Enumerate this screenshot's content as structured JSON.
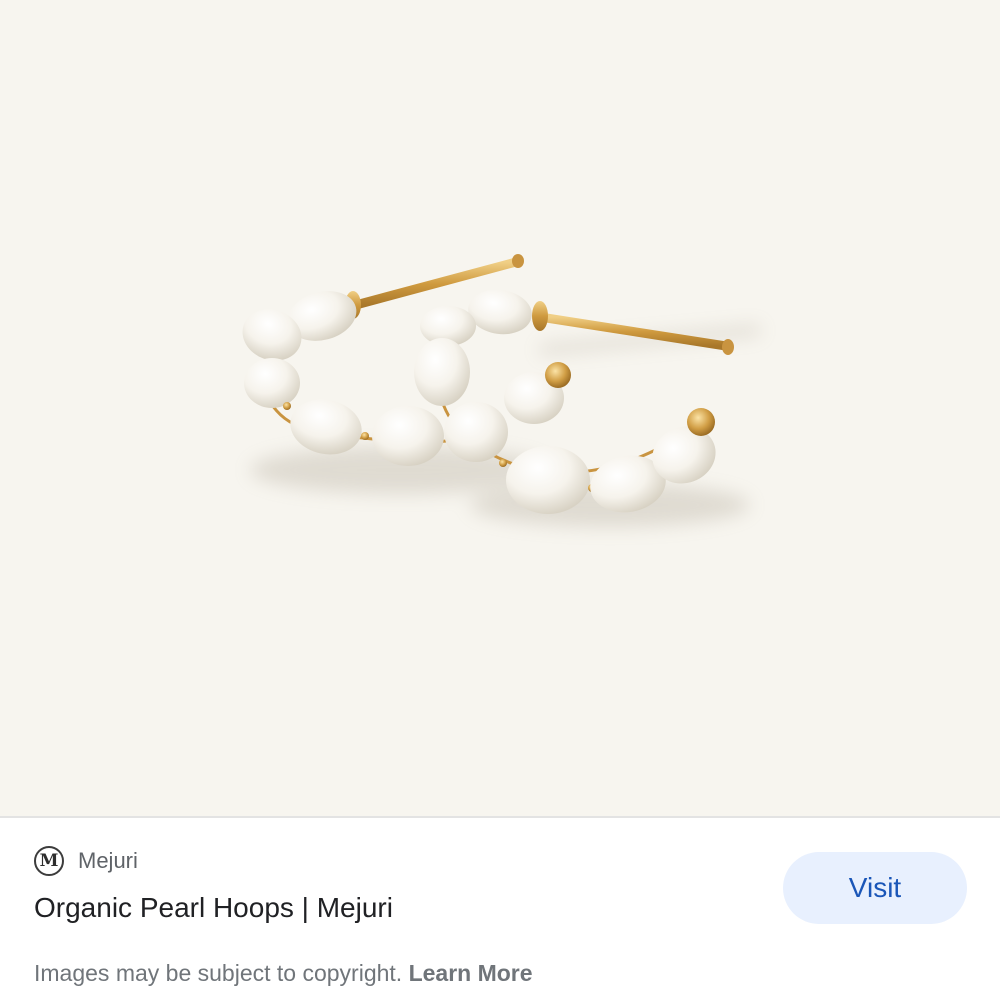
{
  "product_image": {
    "alt": "Organic Pearl Hoops | Mejuri",
    "background": "#f7f5ef",
    "pearl_color": "#f4f2ec",
    "gold_color": "#d4a34a"
  },
  "source": {
    "logo_letter": "M",
    "name": "Mejuri"
  },
  "title": "Organic Pearl Hoops | Mejuri",
  "visit_button": {
    "label": "Visit",
    "color": "#1a56b8",
    "background": "#e8f0fe"
  },
  "copyright": {
    "text": "Images may be subject to copyright. ",
    "link_label": "Learn More"
  }
}
